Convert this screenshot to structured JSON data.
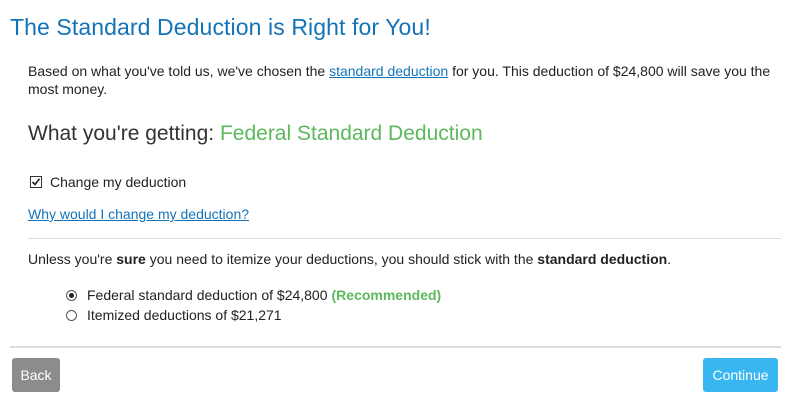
{
  "title": "The Standard Deduction is Right for You!",
  "intro": {
    "before": "Based on what you've told us, we've chosen the ",
    "link": "standard deduction",
    "after": " for you. This deduction of $24,800 will save you the most money."
  },
  "getting": {
    "label": "What you're getting: ",
    "value": "Federal Standard Deduction"
  },
  "change_checkbox": {
    "label": "Change my deduction",
    "checked": true
  },
  "why_link": "Why would I change my deduction?",
  "advice": {
    "part1": "Unless you're ",
    "emphasis1": "sure",
    "part2": " you need to itemize your deductions, you should stick with the ",
    "emphasis2": "standard deduction",
    "part3": "."
  },
  "options": [
    {
      "label": "Federal standard deduction of $24,800",
      "badge": "(Recommended)",
      "selected": true
    },
    {
      "label": "Itemized deductions of $21,271",
      "badge": "",
      "selected": false
    }
  ],
  "buttons": {
    "back": "Back",
    "continue": "Continue"
  },
  "colors": {
    "title_blue": "#1473b8",
    "green": "#5cb85c",
    "continue_blue": "#38b6f0",
    "back_gray": "#8c8c8c"
  }
}
